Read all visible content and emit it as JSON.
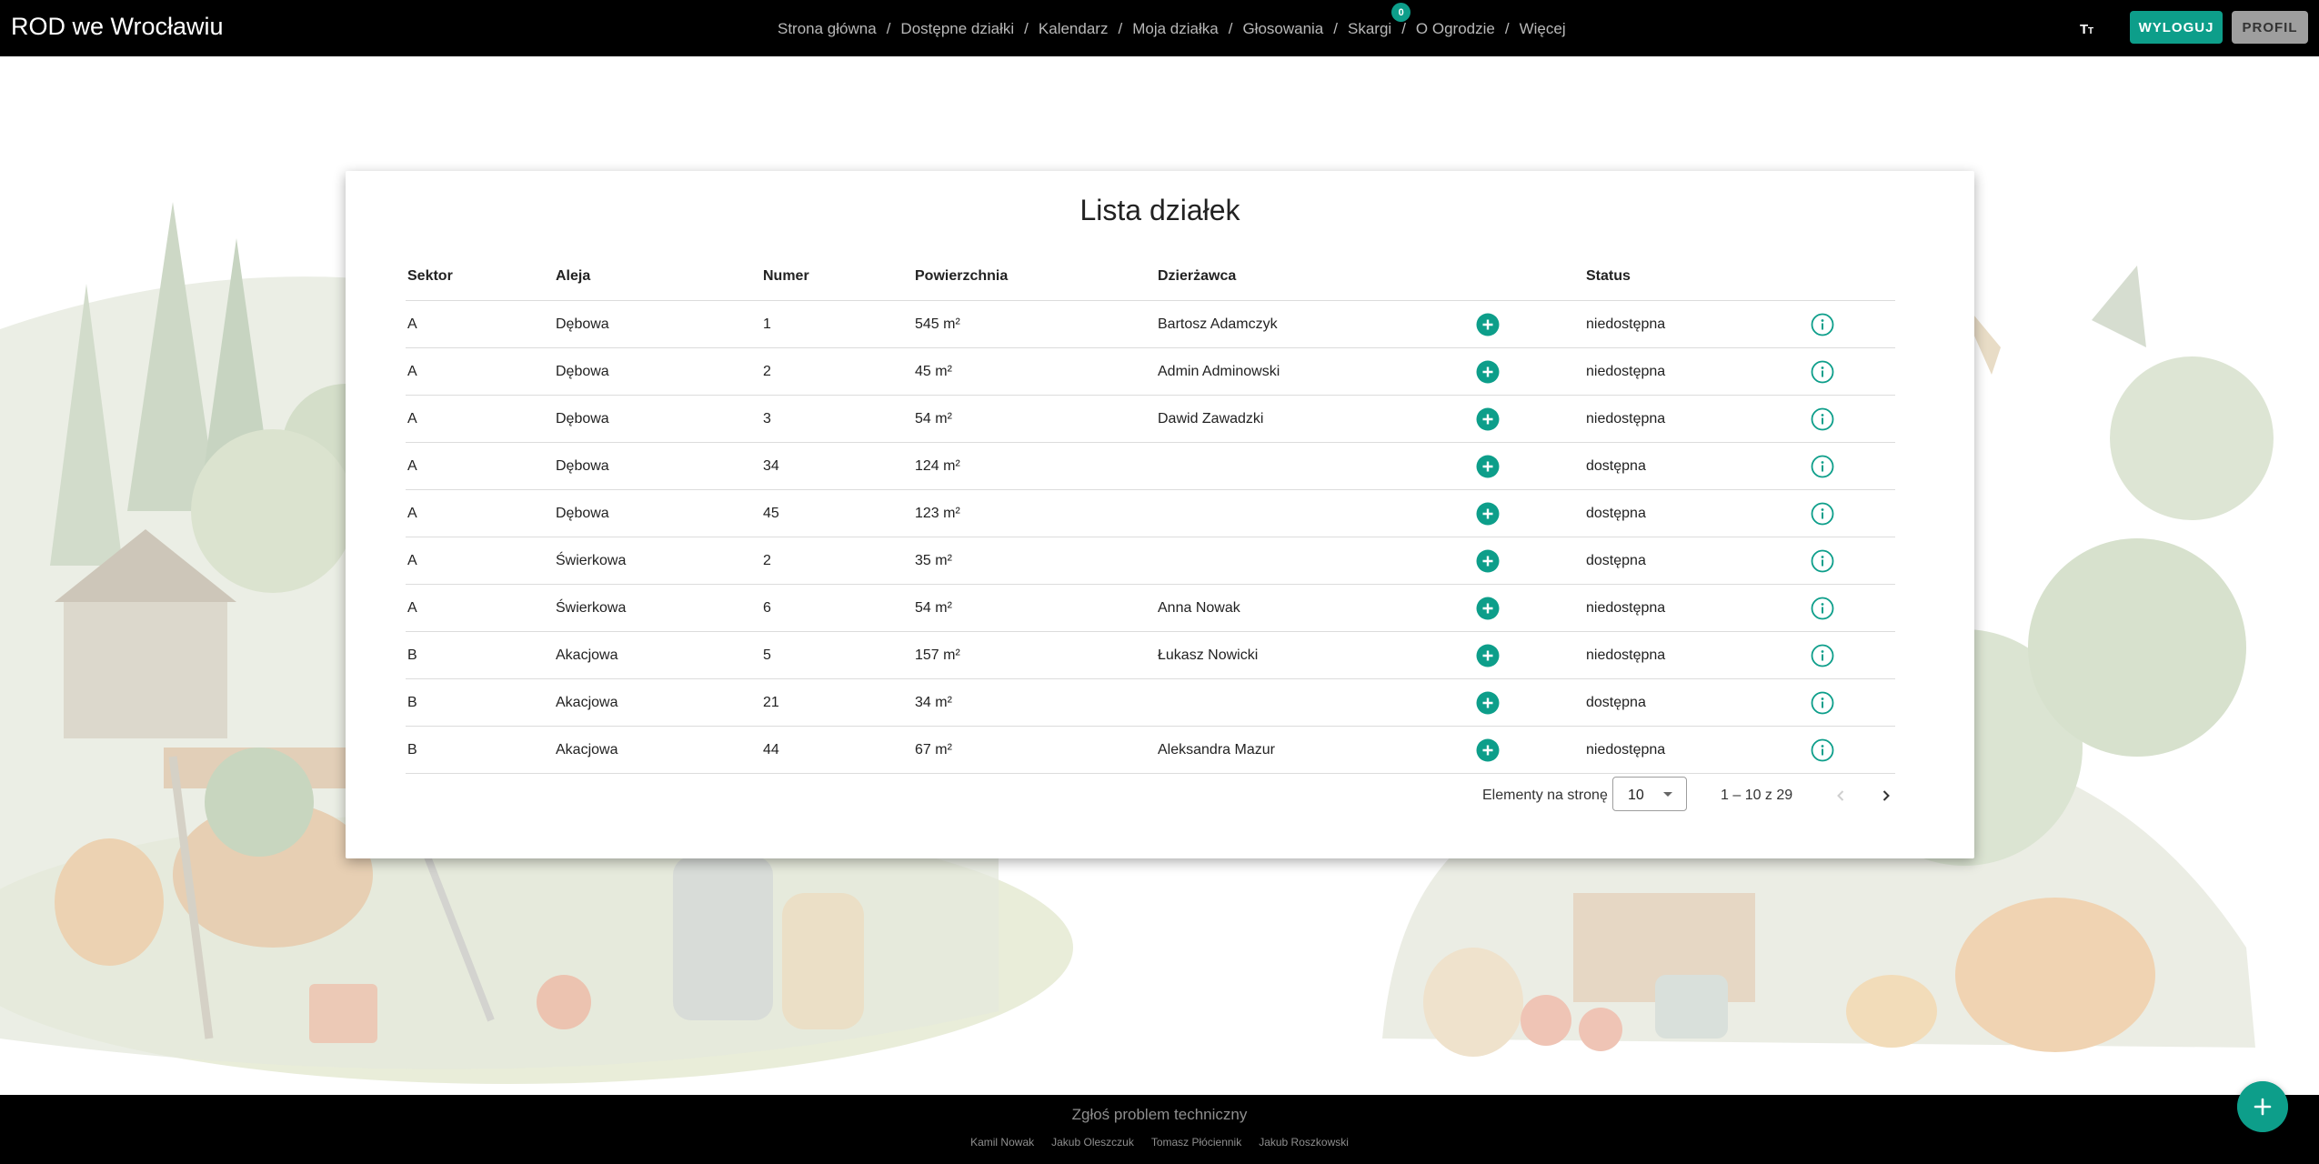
{
  "header": {
    "brand": "ROD we Wrocławiu",
    "nav": [
      {
        "label": "Strona główna"
      },
      {
        "label": "Dostępne działki"
      },
      {
        "label": "Kalendarz"
      },
      {
        "label": "Moja działka"
      },
      {
        "label": "Głosowania"
      },
      {
        "label": "Skargi",
        "badge": "0"
      },
      {
        "label": "O Ogrodzie"
      },
      {
        "label": "Więcej"
      }
    ],
    "separator": "/",
    "text_size_icon": "text-size-icon",
    "logout_label": "WYLOGUJ",
    "profile_label": "PROFIL"
  },
  "main": {
    "title": "Lista działek",
    "columns": {
      "sector": "Sektor",
      "alley": "Aleja",
      "number": "Numer",
      "area": "Powierzchnia",
      "tenant": "Dzierżawca",
      "status": "Status"
    },
    "rows": [
      {
        "sector": "A",
        "alley": "Dębowa",
        "number": "1",
        "area": "545 m²",
        "tenant": "Bartosz Adamczyk",
        "status": "niedostępna"
      },
      {
        "sector": "A",
        "alley": "Dębowa",
        "number": "2",
        "area": "45 m²",
        "tenant": "Admin Adminowski",
        "status": "niedostępna"
      },
      {
        "sector": "A",
        "alley": "Dębowa",
        "number": "3",
        "area": "54 m²",
        "tenant": "Dawid Zawadzki",
        "status": "niedostępna"
      },
      {
        "sector": "A",
        "alley": "Dębowa",
        "number": "34",
        "area": "124 m²",
        "tenant": "",
        "status": "dostępna"
      },
      {
        "sector": "A",
        "alley": "Dębowa",
        "number": "45",
        "area": "123 m²",
        "tenant": "",
        "status": "dostępna"
      },
      {
        "sector": "A",
        "alley": "Świerkowa",
        "number": "2",
        "area": "35 m²",
        "tenant": "",
        "status": "dostępna"
      },
      {
        "sector": "A",
        "alley": "Świerkowa",
        "number": "6",
        "area": "54 m²",
        "tenant": "Anna Nowak",
        "status": "niedostępna"
      },
      {
        "sector": "B",
        "alley": "Akacjowa",
        "number": "5",
        "area": "157 m²",
        "tenant": "Łukasz Nowicki",
        "status": "niedostępna"
      },
      {
        "sector": "B",
        "alley": "Akacjowa",
        "number": "21",
        "area": "34 m²",
        "tenant": "",
        "status": "dostępna"
      },
      {
        "sector": "B",
        "alley": "Akacjowa",
        "number": "44",
        "area": "67 m²",
        "tenant": "Aleksandra Mazur",
        "status": "niedostępna"
      }
    ],
    "row_icons": {
      "add": "plus-circle-icon",
      "info": "info-circle-icon"
    },
    "paginator": {
      "page_size_label": "Elementy na stronę",
      "page_size": "10",
      "range": "1 – 10 z 29",
      "prev_icon": "chevron-left-icon",
      "next_icon": "chevron-right-icon"
    }
  },
  "footer": {
    "report_link": "Zgłoś problem techniczny",
    "authors": [
      "Kamil Nowak",
      "Jakub Oleszczuk",
      "Tomasz Płóciennik",
      "Jakub Roszkowski"
    ]
  },
  "fab_icon": "plus-icon",
  "colors": {
    "accent": "#0d9e8a",
    "header_bg": "#000000",
    "profile_button": "#9e9e9e"
  }
}
